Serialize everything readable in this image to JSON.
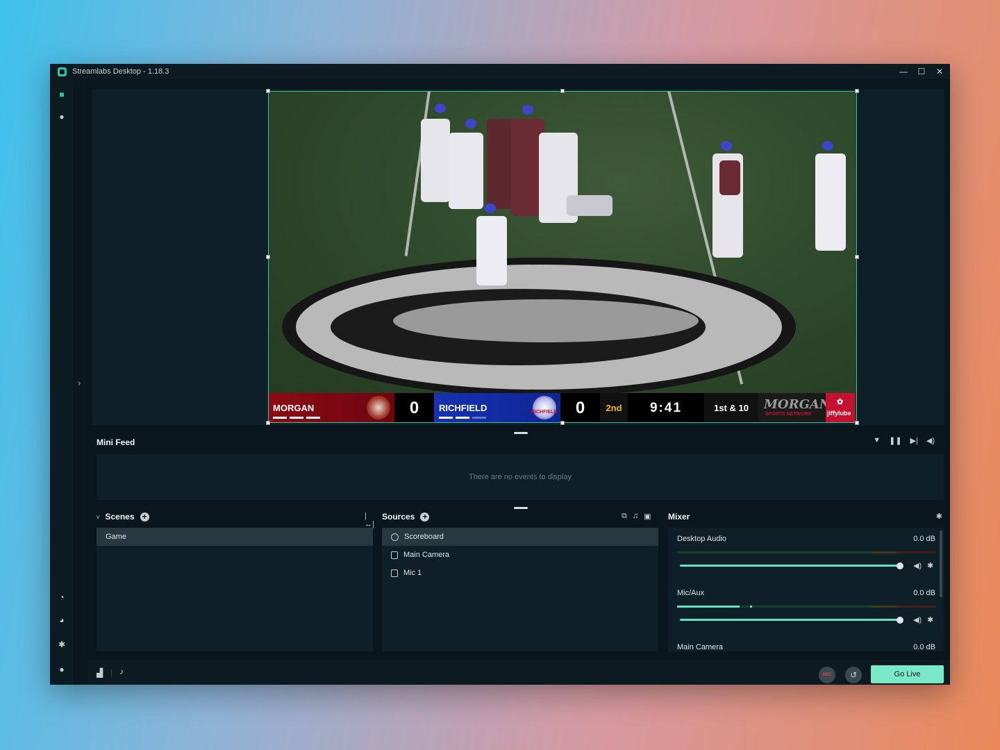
{
  "window": {
    "title": "Streamlabs Desktop - 1.18.3"
  },
  "window_controls": {
    "minimize": "—",
    "maximize": "☐",
    "close": "✕"
  },
  "scoreboard": {
    "home_name": "MORGAN",
    "home_score": "0",
    "away_name": "RICHFIELD",
    "away_score": "0",
    "quarter": "2nd",
    "clock": "9:41",
    "down": "1st & 10",
    "network_line1": "MORGAN",
    "network_line2": "SPORTS NETWORK",
    "sponsor": "jiffylube",
    "away_logo_text": "RICHFIELD",
    "colors": {
      "home": "#8d0a14",
      "away": "#1632b3",
      "quarter": "#f5b623"
    }
  },
  "minifeed": {
    "title": "Mini Feed",
    "empty_text": "There are no events to display"
  },
  "scenes": {
    "title": "Scenes",
    "collapse_glyph": "v",
    "items": [
      {
        "label": "Game"
      }
    ]
  },
  "sources": {
    "title": "Sources",
    "items": [
      {
        "label": "Scoreboard",
        "icon": "globe-icon"
      },
      {
        "label": "Main Camera",
        "icon": "file-icon"
      },
      {
        "label": "Mic 1",
        "icon": "file-icon"
      }
    ]
  },
  "mixer": {
    "title": "Mixer",
    "rows": [
      {
        "label": "Desktop Audio",
        "db": "0.0 dB",
        "level": 0.0
      },
      {
        "label": "Mic/Aux",
        "db": "0.0 dB",
        "level": 0.24
      },
      {
        "label": "Main Camera",
        "db": "0.0 dB",
        "level": 0.0
      }
    ]
  },
  "footer": {
    "rec_label": "REC",
    "golive_label": "Go Live"
  },
  "colors": {
    "accent": "#31c3a2",
    "golive": "#7be8c8",
    "bg": "#09161d"
  }
}
